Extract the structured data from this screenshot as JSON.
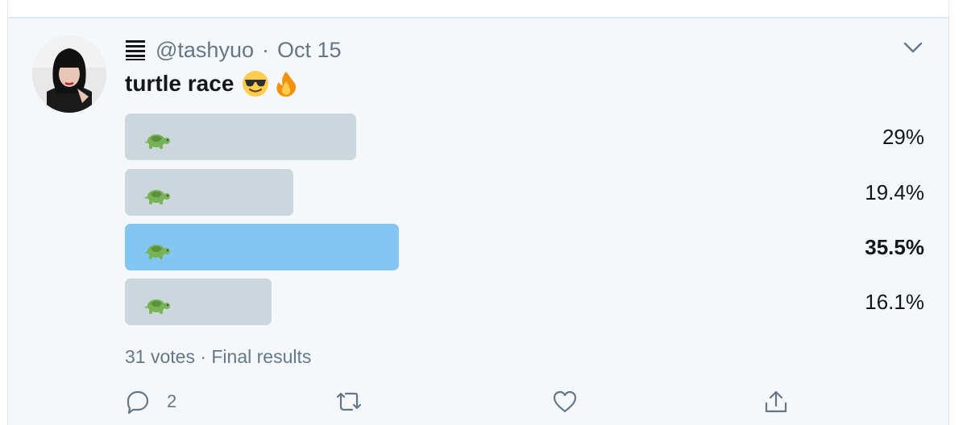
{
  "tweet": {
    "handle": "@tashyuo",
    "separator": "·",
    "date": "Oct 15",
    "text": "turtle race",
    "emojis": [
      "sunglasses-emoji",
      "fire-emoji"
    ]
  },
  "poll": {
    "options": [
      {
        "label_icon": "turtle-emoji",
        "percent": 29,
        "percent_label": "29%",
        "winner": false
      },
      {
        "label_icon": "turtle-emoji",
        "percent": 19.4,
        "percent_label": "19.4%",
        "winner": false
      },
      {
        "label_icon": "turtle-emoji",
        "percent": 35.5,
        "percent_label": "35.5%",
        "winner": true
      },
      {
        "label_icon": "turtle-emoji",
        "percent": 16.1,
        "percent_label": "16.1%",
        "winner": false
      }
    ],
    "meta": "31 votes · Final results"
  },
  "actions": {
    "reply_count": "2",
    "icons": [
      "reply-icon",
      "retweet-icon",
      "like-icon",
      "share-icon"
    ]
  },
  "colors": {
    "bar": "#ccd6dd",
    "bar_winner": "#84c6f2",
    "muted": "#657786",
    "text": "#14171a"
  }
}
